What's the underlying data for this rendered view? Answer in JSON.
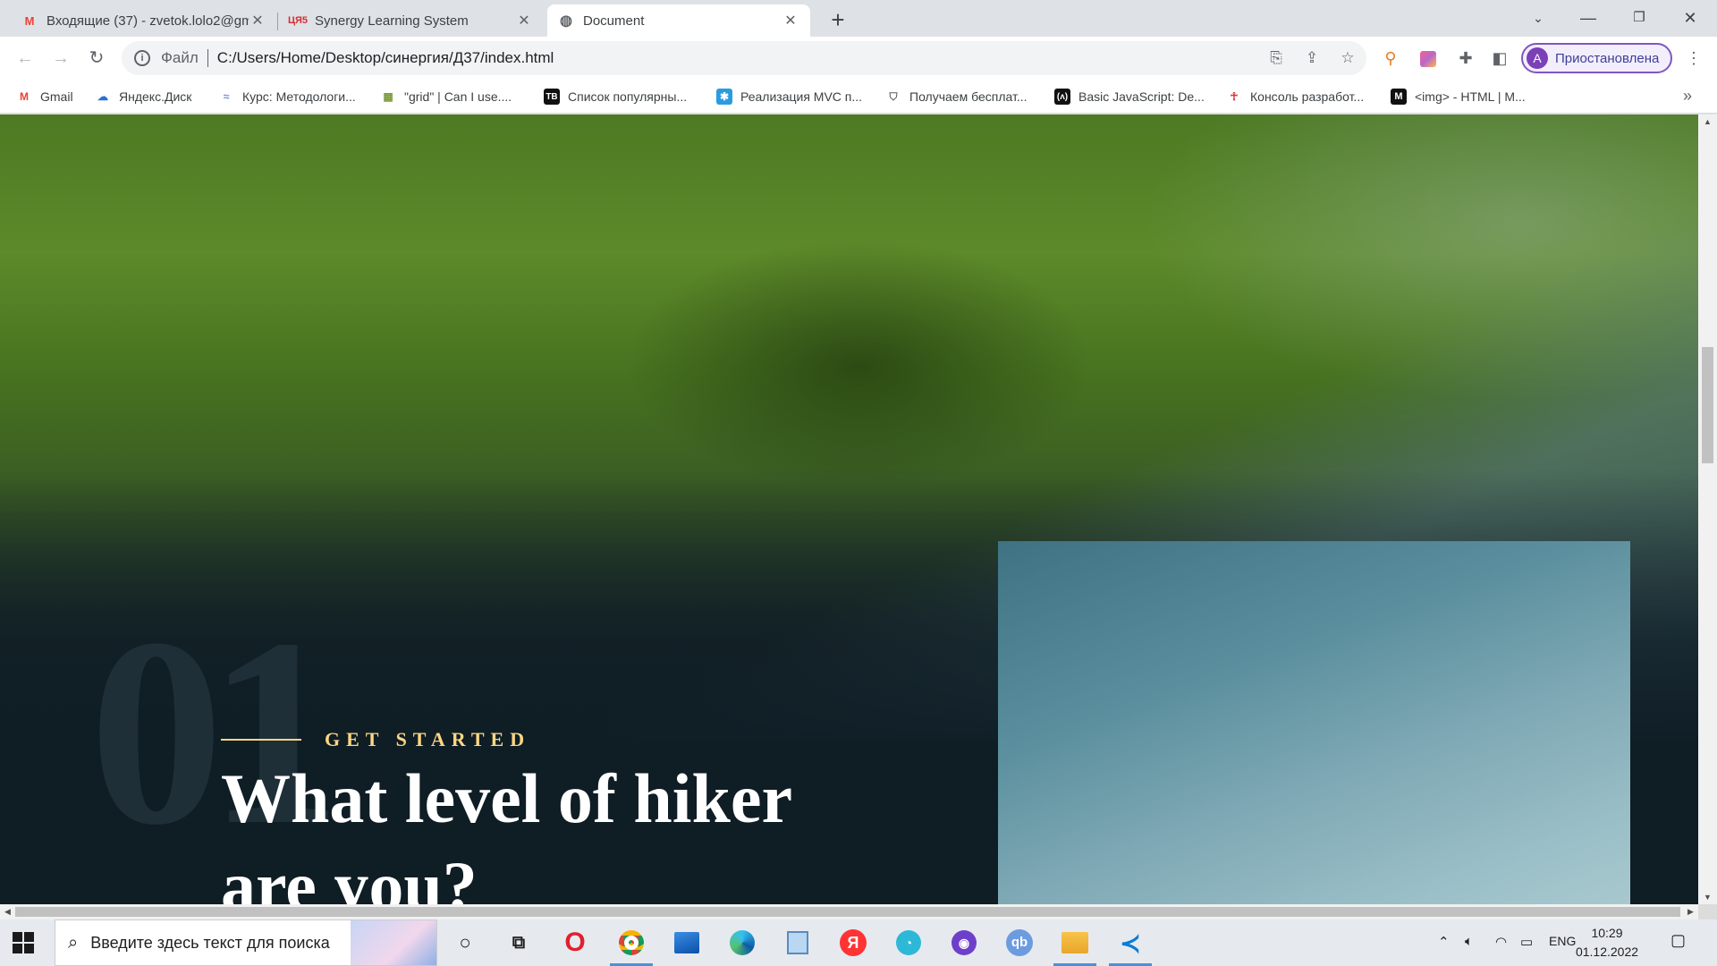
{
  "browser": {
    "tabs": [
      {
        "title": "Входящие (37) - zvetok.lolo2@gm",
        "favicon": "gmail-icon",
        "active": false
      },
      {
        "title": "Synergy Learning System",
        "favicon": "synergy-icon",
        "active": false
      },
      {
        "title": "Document",
        "favicon": "globe-icon",
        "active": true
      }
    ],
    "address": {
      "scheme_label": "Файл",
      "url": "C:/Users/Home/Desktop/синергия/Д37/index.html"
    },
    "profile": {
      "initial": "A",
      "label": "Приостановлена"
    },
    "bookmarks": [
      {
        "label": "Gmail"
      },
      {
        "label": "Яндекс.Диск"
      },
      {
        "label": "Курс: Методологи..."
      },
      {
        "label": "\"grid\" | Can I use...."
      },
      {
        "label": "Список популярны..."
      },
      {
        "label": "Реализация MVC п..."
      },
      {
        "label": "Получаем бесплат..."
      },
      {
        "label": "Basic JavaScript: De..."
      },
      {
        "label": "Консоль разработ..."
      },
      {
        "label": "<img> - HTML | M..."
      }
    ]
  },
  "page": {
    "number": "01",
    "kicker": "GET STARTED",
    "heading": "What level of hiker are you?",
    "accent_color": "#fbd784",
    "background_color": "#0f1d25"
  },
  "taskbar": {
    "search_placeholder": "Введите здесь текст для поиска",
    "language": "ENG",
    "time": "10:29",
    "date": "01.12.2022"
  }
}
